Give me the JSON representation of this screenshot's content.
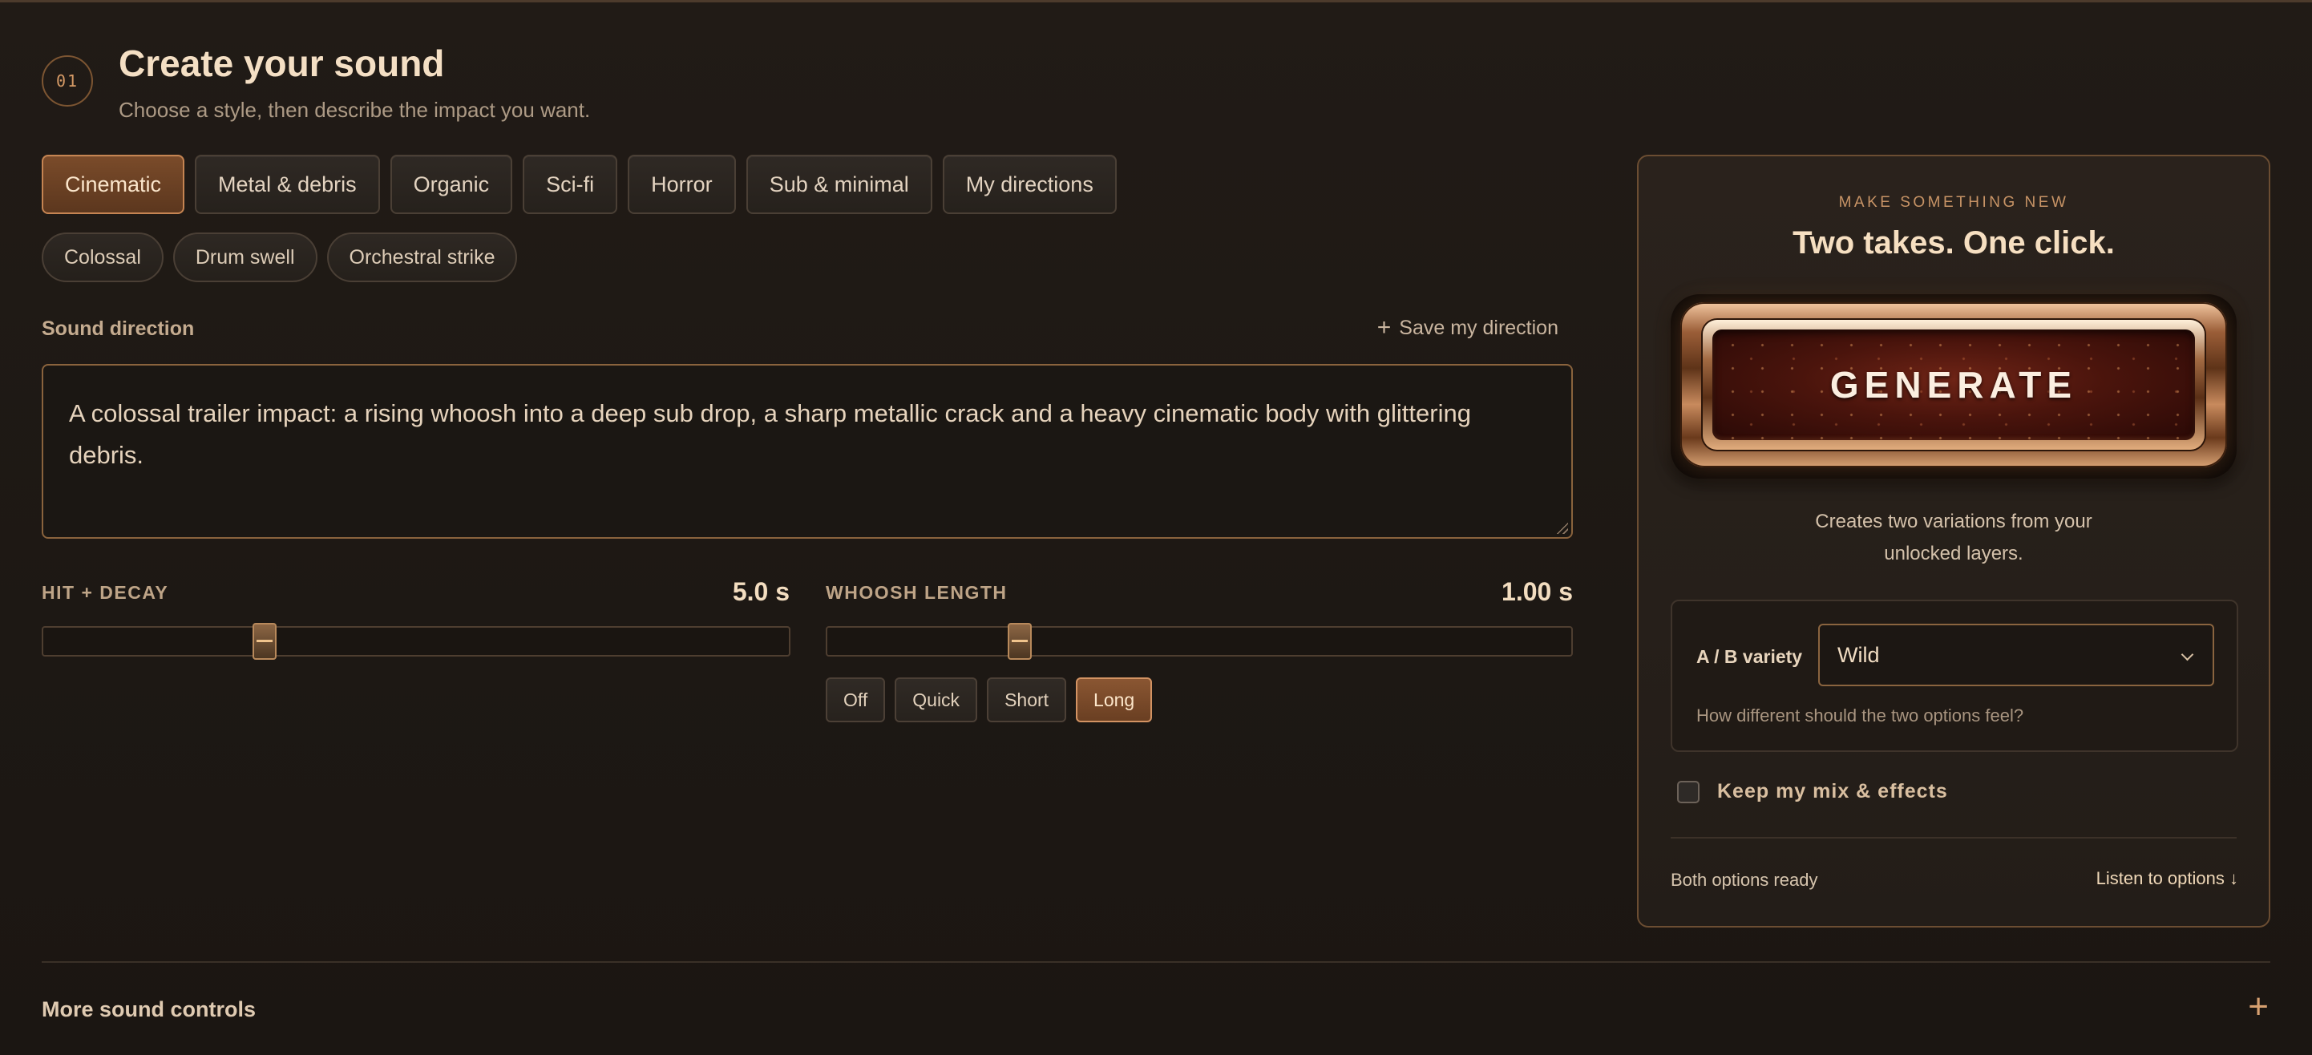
{
  "header": {
    "step": "01",
    "title": "Create your sound",
    "subtitle": "Choose a style, then describe the impact you want."
  },
  "style_tabs": [
    {
      "label": "Cinematic",
      "active": true
    },
    {
      "label": "Metal & debris",
      "active": false
    },
    {
      "label": "Organic",
      "active": false
    },
    {
      "label": "Sci-fi",
      "active": false
    },
    {
      "label": "Horror",
      "active": false
    },
    {
      "label": "Sub & minimal",
      "active": false
    },
    {
      "label": "My directions",
      "active": false
    }
  ],
  "presets": [
    "Colossal",
    "Drum swell",
    "Orchestral strike"
  ],
  "direction": {
    "label": "Sound direction",
    "save_label": "Save my direction",
    "text": "A colossal trailer impact: a rising whoosh into a deep sub drop, a sharp metallic crack and a heavy cinematic body with glittering debris."
  },
  "sliders": {
    "hit_decay": {
      "label": "HIT + DECAY",
      "value": "5.0 s",
      "fraction": 0.29
    },
    "whoosh_length": {
      "label": "WHOOSH LENGTH",
      "value": "1.00 s",
      "fraction": 0.25
    }
  },
  "whoosh_presets": [
    {
      "label": "Off",
      "active": false
    },
    {
      "label": "Quick",
      "active": false
    },
    {
      "label": "Short",
      "active": false
    },
    {
      "label": "Long",
      "active": true
    }
  ],
  "panel": {
    "eyebrow": "MAKE SOMETHING NEW",
    "title": "Two takes. One click.",
    "generate_label": "GENERATE",
    "description_line1": "Creates two variations from your",
    "description_line2": "unlocked layers.",
    "variety_label": "A / B variety",
    "variety_value": "Wild",
    "variety_help": "How different should the two options feel?",
    "keep_label": "Keep my mix & effects",
    "keep_checked": false,
    "status_left": "Both options ready",
    "status_right": "Listen to options ↓"
  },
  "footer": {
    "more_controls": "More sound controls",
    "expand_icon": "+"
  },
  "colors": {
    "accent": "#c58452",
    "background": "#1f1a15",
    "panel_border": "#6b4d32"
  }
}
